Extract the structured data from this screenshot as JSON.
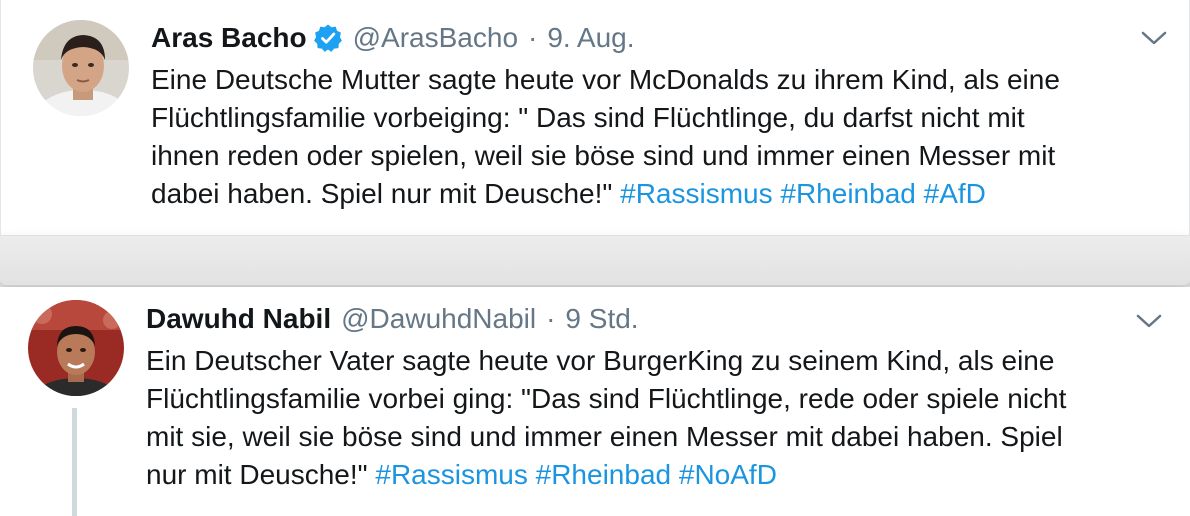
{
  "tweet1": {
    "name": "Aras Bacho",
    "handle": "@ArasBacho",
    "separator": "·",
    "time": "9. Aug.",
    "verified": true,
    "lines": [
      "Eine Deutsche Mutter sagte heute vor McDonalds zu ihrem Kind, als eine",
      "Flüchtlingsfamilie vorbeiging: \" Das sind Flüchtlinge, du darfst nicht mit",
      "ihnen reden oder spielen, weil sie böse sind und immer einen Messer mit",
      "dabei haben. Spiel nur mit Deusche!\""
    ],
    "hashtags": [
      "#Rassismus",
      "#Rheinbad",
      "#AfD"
    ]
  },
  "tweet2": {
    "name": "Dawuhd Nabil",
    "handle": "@DawuhdNabil",
    "separator": "·",
    "time": "9 Std.",
    "verified": false,
    "lines": [
      "Ein Deutscher Vater sagte heute vor BurgerKing zu seinem Kind, als eine",
      "Flüchtlingsfamilie vorbei ging: \"Das sind Flüchtlinge, rede oder spiele nicht",
      "mit sie, weil sie böse sind und immer einen Messer mit dabei haben. Spiel",
      "nur mit Deusche!\""
    ],
    "hashtags": [
      "#Rassismus",
      "#Rheinbad",
      "#NoAfD"
    ]
  },
  "icons": {
    "verified": "verified-badge-icon",
    "menu": "chevron-down-icon"
  },
  "colors": {
    "text": "#14171a",
    "secondary": "#657786",
    "hashtag": "#1b95e0",
    "verified": "#1da1f2",
    "thread_line": "#cfd9de"
  }
}
